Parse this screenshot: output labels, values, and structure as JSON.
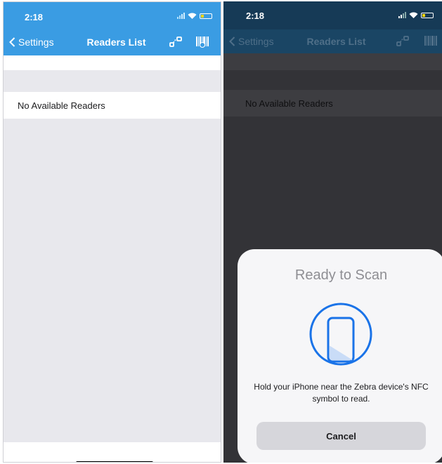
{
  "colors": {
    "nav_blue": "#3a9ce3",
    "nav_blue_dimmed": "#1a4564",
    "list_bg": "#e8e8ed",
    "scan_blue": "#1a73e8"
  },
  "left_screen": {
    "status_bar": {
      "time": "2:18",
      "icons": [
        "signal-icon",
        "wifi-icon",
        "battery-icon"
      ]
    },
    "navbar": {
      "back_label": "Settings",
      "title": "Readers List",
      "actions": [
        "link-devices-icon",
        "barcode-scan-icon"
      ]
    },
    "list": {
      "empty_message": "No Available Readers"
    }
  },
  "right_screen": {
    "status_bar": {
      "time": "2:18",
      "icons": [
        "signal-icon",
        "wifi-icon",
        "battery-icon"
      ]
    },
    "navbar": {
      "back_label": "Settings",
      "title": "Readers List",
      "actions": [
        "link-devices-icon",
        "barcode-scan-icon"
      ]
    },
    "list": {
      "empty_message": "No Available Readers"
    },
    "nfc_sheet": {
      "title": "Ready to Scan",
      "icon": "phone-scan-icon",
      "message": "Hold your iPhone near the Zebra device's NFC symbol to read.",
      "cancel_label": "Cancel"
    }
  }
}
